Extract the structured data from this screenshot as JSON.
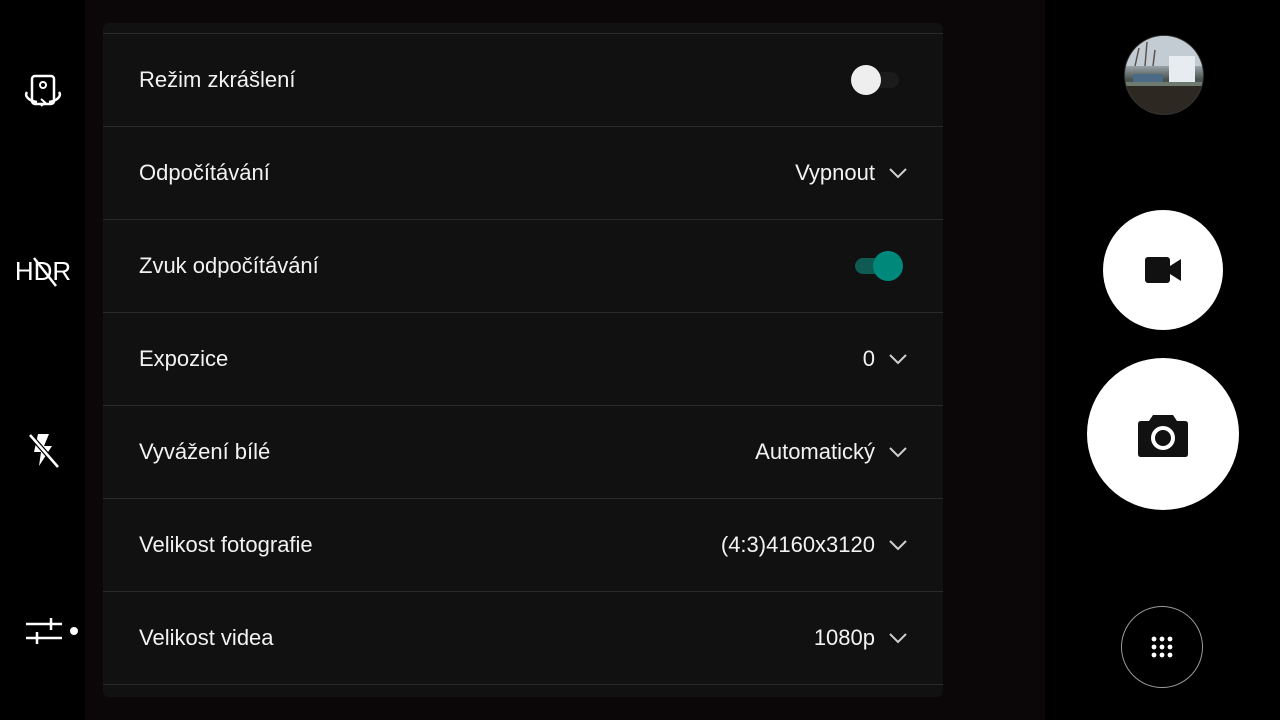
{
  "left_rail": {
    "switch_camera_icon": "camera-switch-icon",
    "hdr_label": "HDR",
    "flash_icon": "flash-off-icon",
    "settings_icon": "sliders-icon"
  },
  "settings": {
    "rows": [
      {
        "label": "Režim zkrášlení",
        "control": "toggle",
        "on": false
      },
      {
        "label": "Odpočítávání",
        "control": "dropdown",
        "value": "Vypnout"
      },
      {
        "label": "Zvuk odpočítávání",
        "control": "toggle",
        "on": true
      },
      {
        "label": "Expozice",
        "control": "dropdown",
        "value": "0"
      },
      {
        "label": "Vyvážení bílé",
        "control": "dropdown",
        "value": "Automatický"
      },
      {
        "label": "Velikost fotografie",
        "control": "dropdown",
        "value": "(4:3)4160x3120"
      },
      {
        "label": "Velikost videa",
        "control": "dropdown",
        "value": "1080p"
      }
    ]
  },
  "right_rail": {
    "gallery_icon": "gallery-thumbnail",
    "video_icon": "video-camera-icon",
    "shutter_icon": "camera-icon",
    "more_icon": "grid-dots-icon"
  },
  "colors": {
    "accent": "#00897b",
    "panel": "#111111",
    "divider": "#2a2a2a"
  }
}
